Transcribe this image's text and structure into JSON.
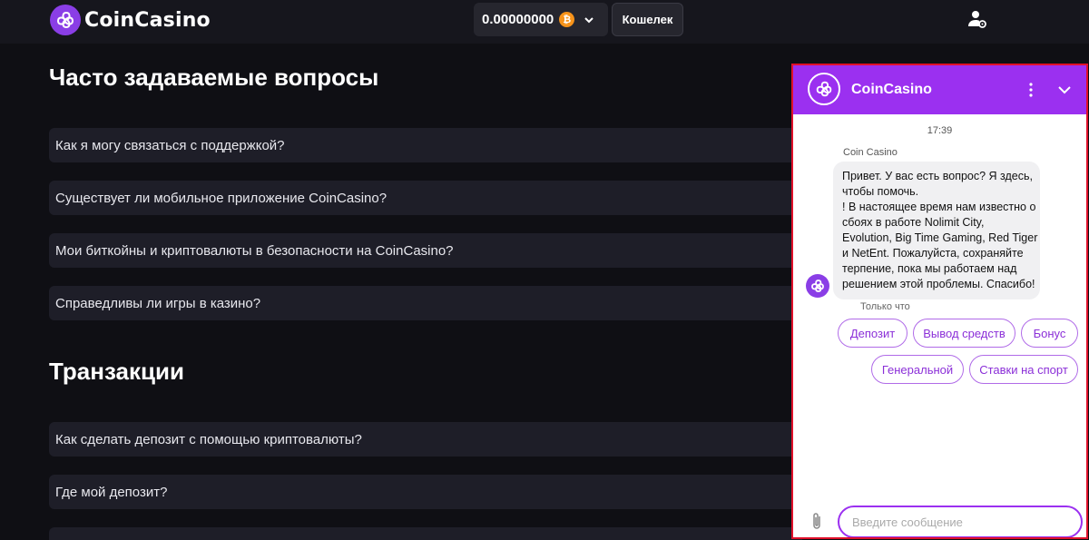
{
  "header": {
    "brand": "CoinCasino",
    "balance": "0.00000000",
    "currency_icon": "bitcoin-icon",
    "wallet_label": "Кошелек",
    "user_icon": "user-settings-icon"
  },
  "faq": {
    "title": "Часто задаваемые вопросы",
    "items": [
      "Как я могу связаться с поддержкой?",
      "Существует ли мобильное приложение CoinCasino?",
      "Мои биткойны и криптовалюты в безопасности на CoinCasino?",
      "Справедливы ли игры в казино?"
    ]
  },
  "transactions": {
    "title": "Транзакции",
    "items": [
      "Как сделать депозит с помощью криптовалюты?",
      "Где мой депозит?"
    ]
  },
  "chat": {
    "title": "CoinCasino",
    "time": "17:39",
    "sender": "Coin Casino",
    "message_lines": [
      "Привет. У вас есть вопрос? Я здесь,",
      "чтобы помочь.",
      "! В настоящее время нам известно о",
      "сбоях в работе Nolimit City,",
      "Evolution, Big Time Gaming, Red Tiger",
      "и NetEnt. Пожалуйста, сохраняйте",
      "терпение, пока мы работаем над",
      "решением этой проблемы. Спасибо!"
    ],
    "status": "Только что",
    "quick_replies": [
      "Депозит",
      "Вывод средств",
      "Бонус",
      "Генеральной",
      "Ставки на спорт"
    ],
    "input_placeholder": "Введите сообщение"
  },
  "colors": {
    "accent": "#9b30f0",
    "page_bg": "#0f0f14",
    "faq_bg": "#1e1e28",
    "bitcoin": "#f7931a",
    "highlight_border": "#e0102a"
  }
}
